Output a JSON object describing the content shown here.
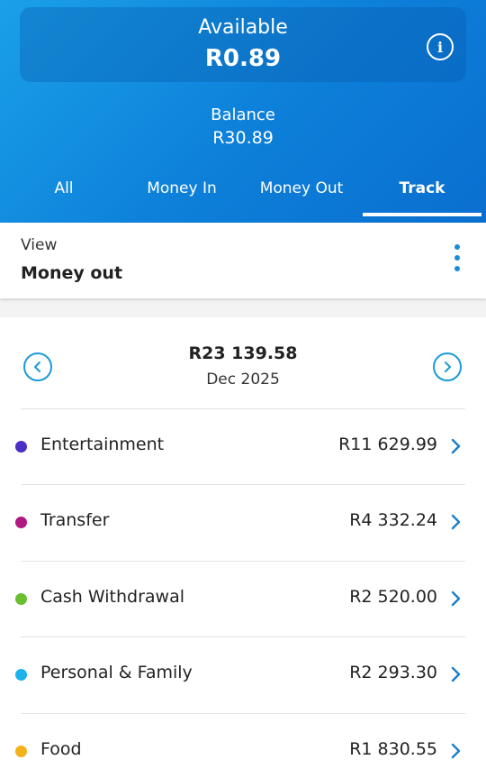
{
  "header": {
    "available_label": "Available",
    "available_value": "R0.89",
    "balance_label": "Balance",
    "balance_value": "R30.89",
    "info_icon": "info-icon",
    "info_glyph": "i"
  },
  "tabs": [
    {
      "label": "All",
      "active": false
    },
    {
      "label": "Money In",
      "active": false
    },
    {
      "label": "Money Out",
      "active": false
    },
    {
      "label": "Track",
      "active": true
    }
  ],
  "view": {
    "label": "View",
    "value": "Money out",
    "menu_icon": "more-vertical-icon"
  },
  "period": {
    "total": "R23 139.58",
    "month": "Dec 2025",
    "prev_icon": "chevron-left-circle-icon",
    "next_icon": "chevron-right-circle-icon"
  },
  "categories": [
    {
      "name": "Entertainment",
      "amount": "R11 629.99",
      "color": "#4b2fc4"
    },
    {
      "name": "Transfer",
      "amount": "R4 332.24",
      "color": "#b0197f"
    },
    {
      "name": "Cash Withdrawal",
      "amount": "R2 520.00",
      "color": "#6abf2f"
    },
    {
      "name": "Personal & Family",
      "amount": "R2 293.30",
      "color": "#1cb3ea"
    },
    {
      "name": "Food",
      "amount": "R1 830.55",
      "color": "#f2b21b"
    }
  ],
  "colors": {
    "header_start": "#1aa0e8",
    "header_end": "#0a6fd0",
    "accent": "#1a9ad6",
    "chevron": "#1b7fc9"
  }
}
